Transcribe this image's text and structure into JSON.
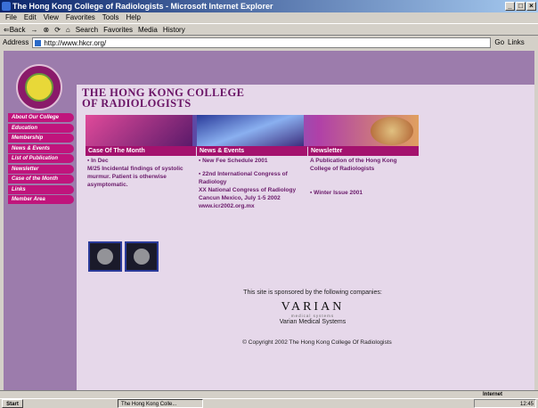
{
  "window": {
    "title": "The Hong Kong College of Radiologists - Microsoft Internet Explorer",
    "btn_min": "_",
    "btn_max": "□",
    "btn_close": "×"
  },
  "menu": [
    "File",
    "Edit",
    "View",
    "Favorites",
    "Tools",
    "Help"
  ],
  "toolbar": {
    "back": "⇐Back",
    "forward": "→",
    "stop": "⊗",
    "refresh": "⟳",
    "home": "⌂",
    "search": "Search",
    "favorites": "Favorites",
    "media": "Media",
    "history": "History"
  },
  "address": {
    "label": "Address",
    "url": "http://www.hkcr.org/",
    "go": "Go",
    "links": "Links"
  },
  "site": {
    "title_line1": "The Hong Kong College",
    "title_line2": "of Radiologists"
  },
  "nav": [
    "About Our College",
    "Education",
    "Membership",
    "News & Events",
    "List of Publication",
    "Newsletter",
    "Case of the Month",
    "Links",
    "Member Area"
  ],
  "case": {
    "header": "Case Of The Month",
    "date": "▪ In Dec",
    "text": "M/25 Incidental findings of systolic murmur. Patient is otherwise asymptomatic."
  },
  "news": {
    "header": "News & Events",
    "item1": "▪ New Fee Schedule 2001",
    "item2": "▪ 22nd International Congress of Radiology",
    "item3": "XX National Congress of Radiology",
    "item4": "Cancun Mexico, July 1-5 2002",
    "item5": "www.icr2002.org.mx"
  },
  "newsletter": {
    "header": "Newsletter",
    "desc": "A Publication of the Hong Kong College of Radiologists",
    "item1": "▪ Winter Issue 2001"
  },
  "sponsor": {
    "text": "This site is sponsored by the following companies:",
    "logo": "VARIAN",
    "logo_sub": "medical systems",
    "name": "Varian Medical Systems"
  },
  "copyright": "© Copyright 2002 The Hong Kong College Of Radiologists",
  "statusbar": {
    "zone": "Internet"
  },
  "taskbar": {
    "start": "Start",
    "item": "The Hong Kong Colle...",
    "clock": "12:45"
  }
}
